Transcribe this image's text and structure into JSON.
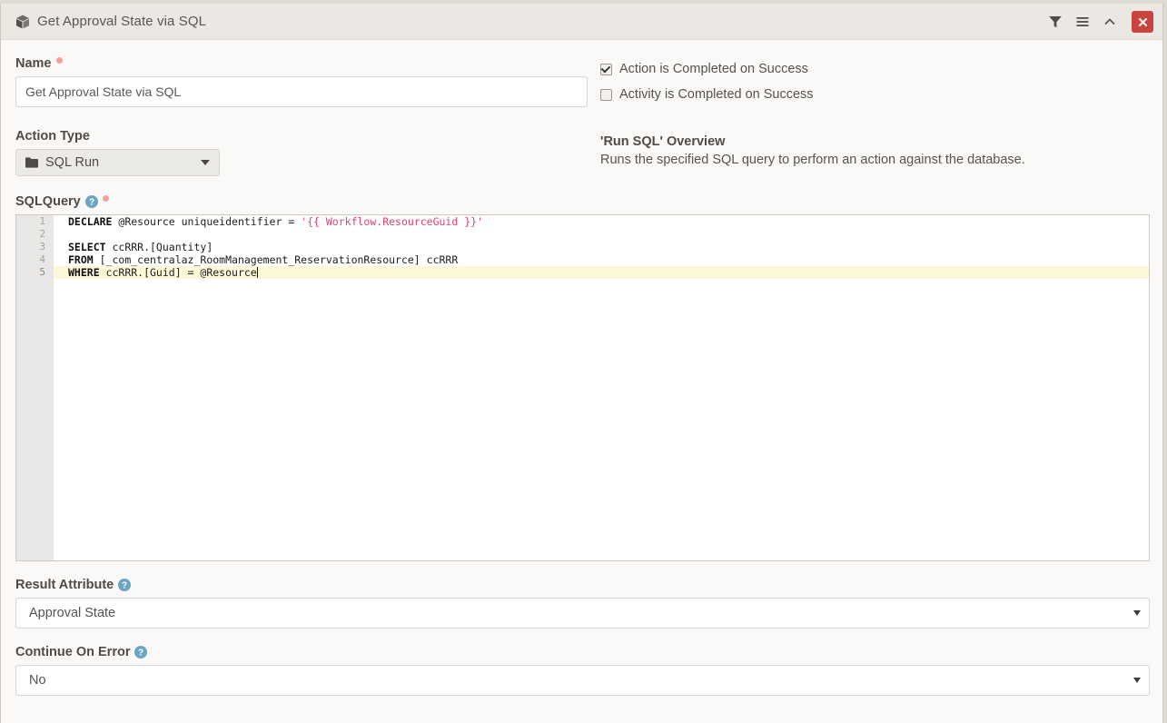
{
  "window": {
    "title": "Get Approval State via SQL",
    "icon": "cube-icon",
    "actions": {
      "filter": "filter-icon",
      "menu": "hamburger-menu-icon",
      "collapse": "chevron-up-icon",
      "close": "close-icon"
    }
  },
  "form": {
    "name": {
      "label": "Name",
      "required": true,
      "value": "Get Approval State via SQL"
    },
    "checkboxes": [
      {
        "label": "Action is Completed on Success",
        "checked": true
      },
      {
        "label": "Activity is Completed on Success",
        "checked": false
      }
    ],
    "action_type": {
      "label": "Action Type",
      "value": "SQL Run",
      "icon": "folder-icon"
    },
    "overview": {
      "title": "'Run SQL' Overview",
      "text": "Runs the specified SQL query to perform an action against the database."
    },
    "sql_query": {
      "label": "SQLQuery",
      "required": true,
      "help": "help-icon",
      "active_line": 5,
      "lines": [
        {
          "number": "1",
          "tokens": [
            {
              "text": "DECLARE",
              "style": "kw"
            },
            {
              "text": " @Resource uniqueidentifier = ",
              "style": "plain"
            },
            {
              "text": "'{{ Workflow.ResourceGuid }}'",
              "style": "str"
            }
          ]
        },
        {
          "number": "2",
          "tokens": []
        },
        {
          "number": "3",
          "tokens": [
            {
              "text": "SELECT",
              "style": "kw"
            },
            {
              "text": " ccRRR.[Quantity]",
              "style": "plain"
            }
          ]
        },
        {
          "number": "4",
          "tokens": [
            {
              "text": "FROM",
              "style": "kw"
            },
            {
              "text": " [_com_centralaz_RoomManagement_ReservationResource] ccRRR",
              "style": "plain"
            }
          ]
        },
        {
          "number": "5",
          "tokens": [
            {
              "text": "WHERE",
              "style": "kw"
            },
            {
              "text": " ccRRR.[Guid] = @Resource",
              "style": "plain"
            }
          ]
        }
      ],
      "raw": "DECLARE @Resource uniqueidentifier = '{{ Workflow.ResourceGuid }}'\n\nSELECT ccRRR.[Quantity]\nFROM [_com_centralaz_RoomManagement_ReservationResource] ccRRR\nWHERE ccRRR.[Guid] = @Resource"
    },
    "result_attribute": {
      "label": "Result Attribute",
      "help": "help-icon",
      "value": "Approval State"
    },
    "continue_on_error": {
      "label": "Continue On Error",
      "help": "help-icon",
      "value": "No"
    }
  },
  "colors": {
    "titlebar_bg": "#ebe8e3",
    "panel_bg": "#faf9f7",
    "close_red": "#c9433f",
    "string_literal": "#e0416f",
    "active_line": "#fcf8d8",
    "help_blue": "#6aa6c4",
    "required_dot": "#f2a0a0"
  }
}
